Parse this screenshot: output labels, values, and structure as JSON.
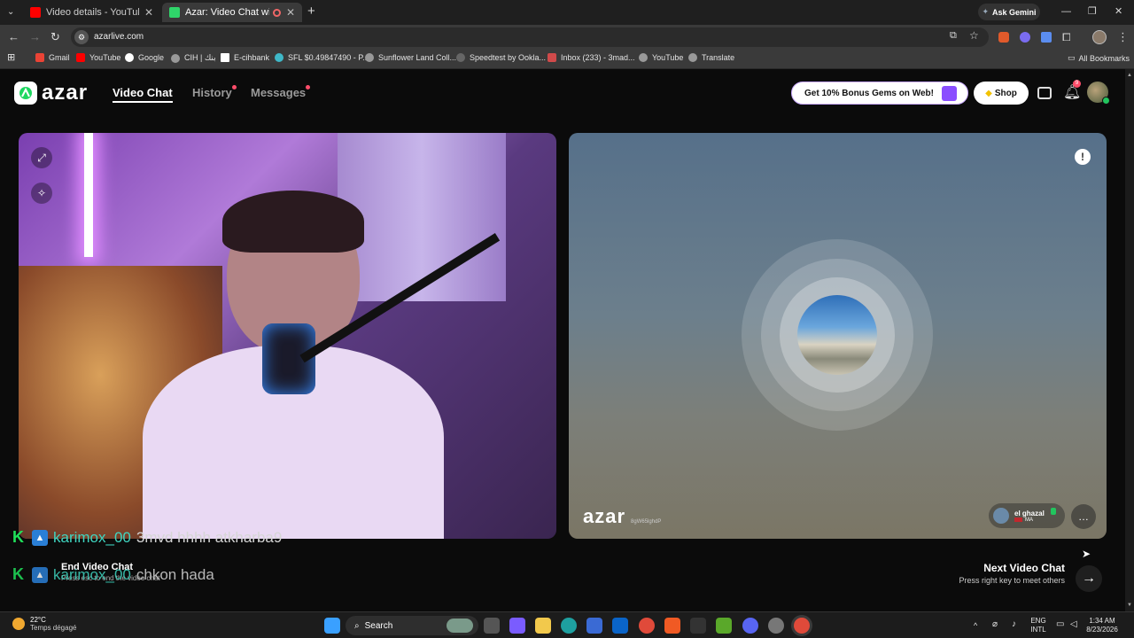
{
  "browser": {
    "tabs": [
      {
        "title": "Video details - YouTube Studio",
        "active": false,
        "color": "#ff0000"
      },
      {
        "title": "Azar: Video Chat with New",
        "active": true,
        "color": "#2fd56a"
      }
    ],
    "ask_gemini": "Ask Gemini",
    "url": "azarlive.com",
    "bookmarks": [
      "Gmail",
      "YouTube",
      "Google",
      "CIH | بنك",
      "E-cihbank",
      "SFL $0.49847490 - P...",
      "Sunflower Land Coll...",
      "Speedtest by Ookla...",
      "Inbox (233) - 3mad...",
      "YouTube",
      "Translate"
    ],
    "all_bookmarks": "All Bookmarks"
  },
  "azar": {
    "logo": "azar",
    "nav": {
      "video_chat": "Video Chat",
      "history": "History",
      "messages": "Messages"
    },
    "promo": "Get 10% Bonus Gems on Web!",
    "shop": "Shop",
    "notification_count": "9",
    "remote": {
      "watermark": "azar",
      "watermark_id": "8gW65lghdP",
      "name": "el ghazal",
      "country": "MA"
    },
    "end_chat": {
      "title": "End Video Chat",
      "hint": "Press esc to end the video chat"
    },
    "next_chat": {
      "title": "Next Video Chat",
      "hint": "Press right key to meet others"
    }
  },
  "overlay_chat": [
    {
      "user": "karimox_00",
      "message": "3mvd hhhh atkharba9"
    },
    {
      "user": "karimox_00",
      "message": "chkon hada"
    }
  ],
  "taskbar": {
    "weather_temp": "22°C",
    "weather_desc": "Temps dégagé",
    "search": "Search",
    "lang": "ENG",
    "lang2": "INTL",
    "time": "1:34 AM",
    "date": "8/23/2026"
  }
}
